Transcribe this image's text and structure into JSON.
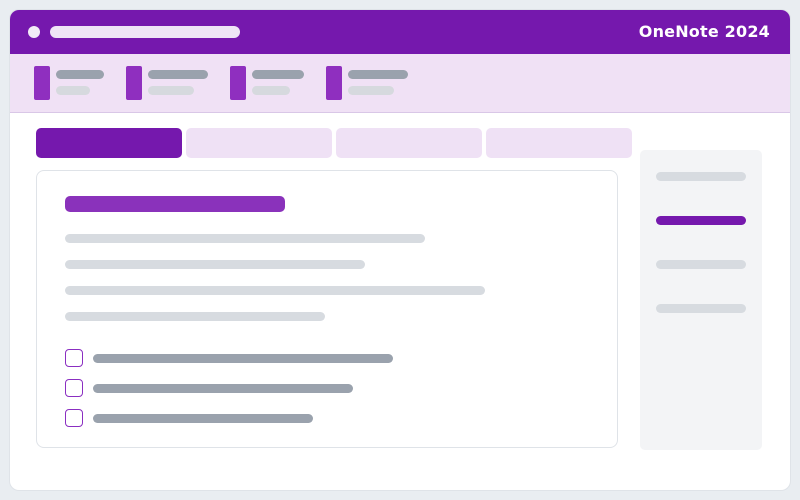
{
  "app": {
    "title": "OneNote 2024"
  },
  "colors": {
    "brand": "#7518ad",
    "ribbon_background": "#f0e1f5",
    "accent_title": "#8a32bb",
    "text_placeholder": "#d7dbe0",
    "secondary_text": "#9aa2ad"
  },
  "ribbon": {
    "items": [
      {
        "id": "ribbon-item-1",
        "icon": "ribbon-command-icon"
      },
      {
        "id": "ribbon-item-2",
        "icon": "ribbon-command-icon"
      },
      {
        "id": "ribbon-item-3",
        "icon": "ribbon-command-icon"
      },
      {
        "id": "ribbon-item-4",
        "icon": "ribbon-command-icon"
      }
    ]
  },
  "tabs": [
    {
      "id": "tab-1",
      "selected": true
    },
    {
      "id": "tab-2",
      "selected": false
    },
    {
      "id": "tab-3",
      "selected": false
    },
    {
      "id": "tab-4",
      "selected": false
    }
  ],
  "page": {
    "todos": [
      {
        "checked": false
      },
      {
        "checked": false
      },
      {
        "checked": false
      }
    ]
  },
  "sidebar": {
    "selected_index": 1,
    "item_count": 4
  }
}
